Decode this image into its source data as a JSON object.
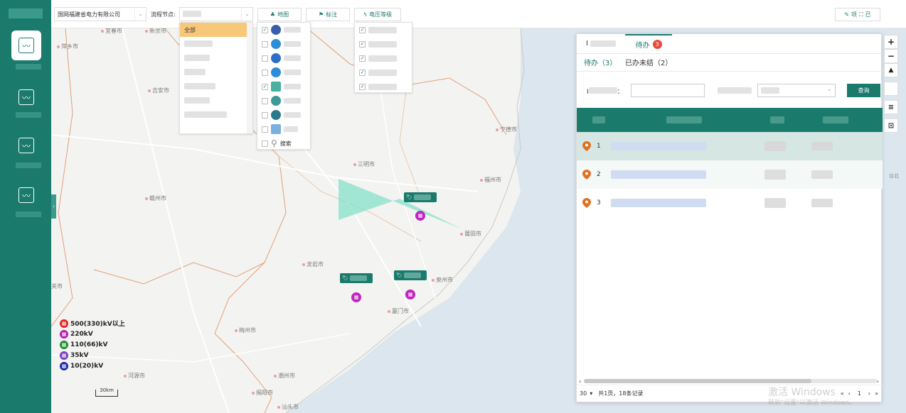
{
  "topbar": {
    "company_select": "国网福建省电力有限公司",
    "flow_node_label": "流程节点:",
    "btn_map": "地图",
    "btn_mark": "标注",
    "btn_voltage": "电压等级",
    "btn_right_label": "项",
    "btn_right_label_2": "已"
  },
  "flow_dropdown": {
    "options": [
      "全部"
    ]
  },
  "cities": [
    {
      "name": "萍乡市"
    },
    {
      "name": "吉安市"
    },
    {
      "name": "赣州市"
    },
    {
      "name": "三明市"
    },
    {
      "name": "宁德市"
    },
    {
      "name": "福州市"
    },
    {
      "name": "莆田市"
    },
    {
      "name": "龙岩市"
    },
    {
      "name": "泉州市"
    },
    {
      "name": "厦门市"
    },
    {
      "name": "梅州市"
    },
    {
      "name": "河源市"
    },
    {
      "name": "潮州市"
    },
    {
      "name": "揭阳市"
    },
    {
      "name": "汕头市"
    },
    {
      "name": "关市"
    },
    {
      "name": "宜春市"
    },
    {
      "name": "新余市"
    }
  ],
  "legend": [
    {
      "label": "500(330)kV以上",
      "color": "#e02424"
    },
    {
      "label": "220kV",
      "color": "#b020b0"
    },
    {
      "label": "110(66)kV",
      "color": "#1f8f2f"
    },
    {
      "label": "35kV",
      "color": "#7a3fc0"
    },
    {
      "label": "10(20)kV",
      "color": "#1f2fa0"
    }
  ],
  "scale_label": "30km",
  "panel": {
    "tab_first": "I",
    "tab_active": "待办",
    "tab_badge": "3",
    "subtab_todo": "待办（3）",
    "subtab_done": "已办未结（2）",
    "query_label_prefix": "I",
    "query_label_suffix": "：",
    "query_button": "查询",
    "rows": [
      {
        "index": "1"
      },
      {
        "index": "2"
      },
      {
        "index": "3"
      }
    ],
    "footer_pagesize": "30",
    "footer_summary": "共1页，18条记录",
    "footer_page": "1"
  },
  "layers_dropdown": {
    "last_item_label": "搜索"
  },
  "watermark": {
    "line1": "激活 Windows",
    "line2": "转到\"设置\"以激活 Windows。"
  },
  "taiwan_label": "台北"
}
